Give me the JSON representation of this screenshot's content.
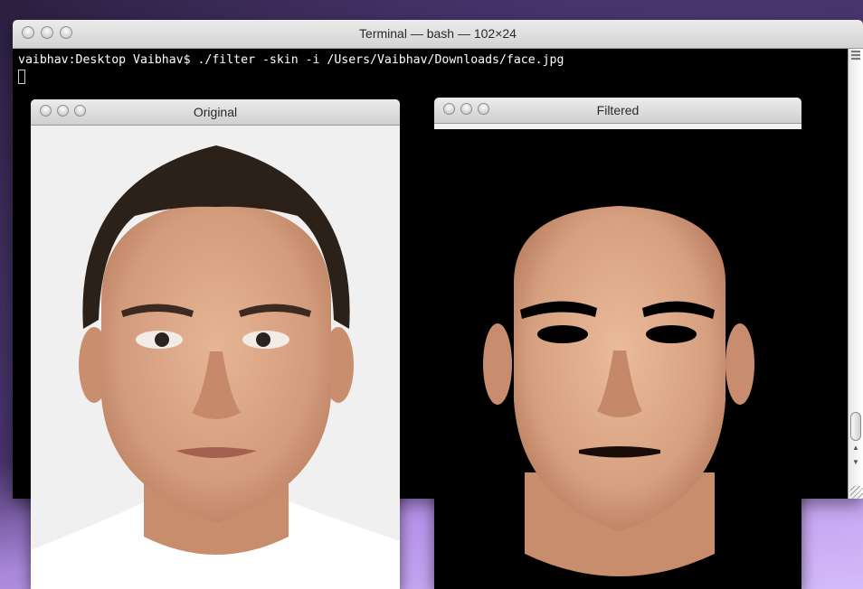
{
  "terminal": {
    "title": "Terminal — bash — 102×24",
    "prompt_line": "vaibhav:Desktop Vaibhav$ ./filter -skin -i /Users/Vaibhav/Downloads/face.jpg"
  },
  "windows": {
    "original": {
      "title": "Original"
    },
    "filtered": {
      "title": "Filtered"
    }
  },
  "colors": {
    "skin": "#d9a585",
    "hair": "#2b2119",
    "background_original": "#f0f0f0",
    "background_filtered": "#000000"
  }
}
